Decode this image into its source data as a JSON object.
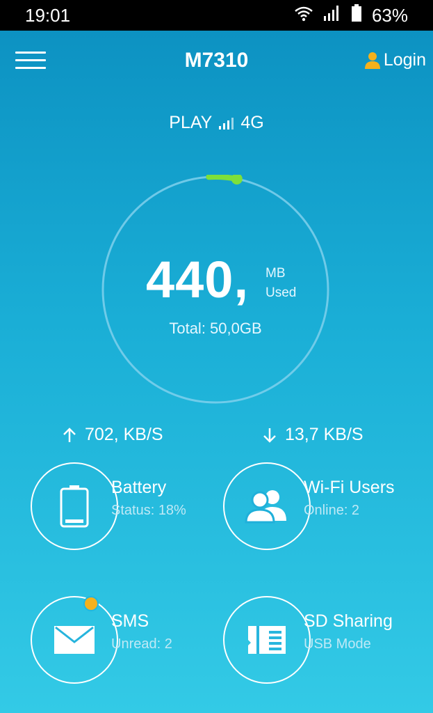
{
  "statusbar": {
    "time": "19:01",
    "battery_percent": "63%"
  },
  "header": {
    "title": "M7310",
    "login_label": "Login"
  },
  "network": {
    "carrier": "PLAY",
    "type": "4G"
  },
  "usage": {
    "amount": "440,",
    "unit": "MB",
    "unit_label": "Used",
    "total": "Total: 50,0GB",
    "fraction_used": 0.009
  },
  "speeds": {
    "upload": "702, KB/S",
    "download": "13,7 KB/S"
  },
  "tiles": [
    {
      "title": "Battery",
      "subtitle": "Status: 18%",
      "icon": "battery-icon"
    },
    {
      "title": "Wi-Fi Users",
      "subtitle": "Online: 2",
      "icon": "users-icon"
    },
    {
      "title": "SMS",
      "subtitle": "Unread: 2",
      "icon": "mail-icon"
    },
    {
      "title": "SD Sharing",
      "subtitle": "USB Mode",
      "icon": "sd-card-icon"
    }
  ],
  "colors": {
    "accent_green": "#7ee03a",
    "badge": "#f4b11c",
    "user_icon": "#f4b11c"
  }
}
